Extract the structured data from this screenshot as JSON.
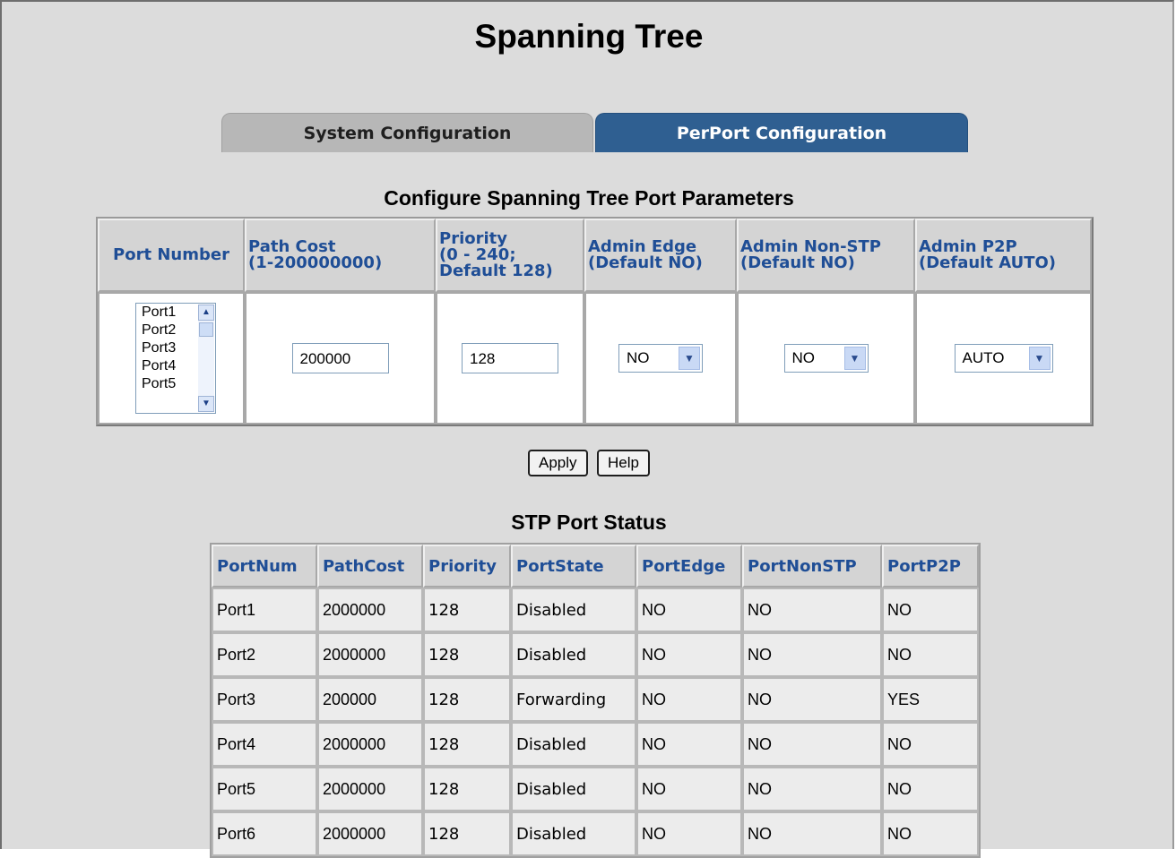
{
  "page": {
    "title": "Spanning Tree"
  },
  "tabs": [
    {
      "label": "System Configuration",
      "active": false
    },
    {
      "label": "PerPort Configuration",
      "active": true
    }
  ],
  "config": {
    "title": "Configure Spanning Tree Port Parameters",
    "headers": {
      "port_number": "Port Number",
      "path_cost": [
        "Path Cost",
        "(1-200000000)"
      ],
      "priority": [
        "Priority",
        "(0 - 240;",
        "Default 128)"
      ],
      "admin_edge": [
        "Admin Edge",
        "(Default NO)"
      ],
      "admin_non_stp": [
        "Admin Non-STP",
        "(Default NO)"
      ],
      "admin_p2p": [
        "Admin P2P",
        "(Default AUTO)"
      ]
    },
    "port_list": [
      "Port1",
      "Port2",
      "Port3",
      "Port4",
      "Port5"
    ],
    "path_cost_value": "200000",
    "priority_value": "128",
    "admin_edge_value": "NO",
    "admin_non_stp_value": "NO",
    "admin_p2p_value": "AUTO"
  },
  "buttons": {
    "apply": "Apply",
    "help": "Help"
  },
  "status": {
    "title": "STP Port Status",
    "columns": [
      "PortNum",
      "PathCost",
      "Priority",
      "PortState",
      "PortEdge",
      "PortNonSTP",
      "PortP2P"
    ],
    "rows": [
      [
        "Port1",
        "2000000",
        "128",
        "Disabled",
        "NO",
        "NO",
        "NO"
      ],
      [
        "Port2",
        "2000000",
        "128",
        "Disabled",
        "NO",
        "NO",
        "NO"
      ],
      [
        "Port3",
        "200000",
        "128",
        "Forwarding",
        "NO",
        "NO",
        "YES"
      ],
      [
        "Port4",
        "2000000",
        "128",
        "Disabled",
        "NO",
        "NO",
        "NO"
      ],
      [
        "Port5",
        "2000000",
        "128",
        "Disabled",
        "NO",
        "NO",
        "NO"
      ],
      [
        "Port6",
        "2000000",
        "128",
        "Disabled",
        "NO",
        "NO",
        "NO"
      ]
    ]
  },
  "colors": {
    "active_tab": "#2f5f91",
    "inactive_tab": "#b7b7b7",
    "header_text": "#1f4e96",
    "background": "#dcdcdc"
  }
}
